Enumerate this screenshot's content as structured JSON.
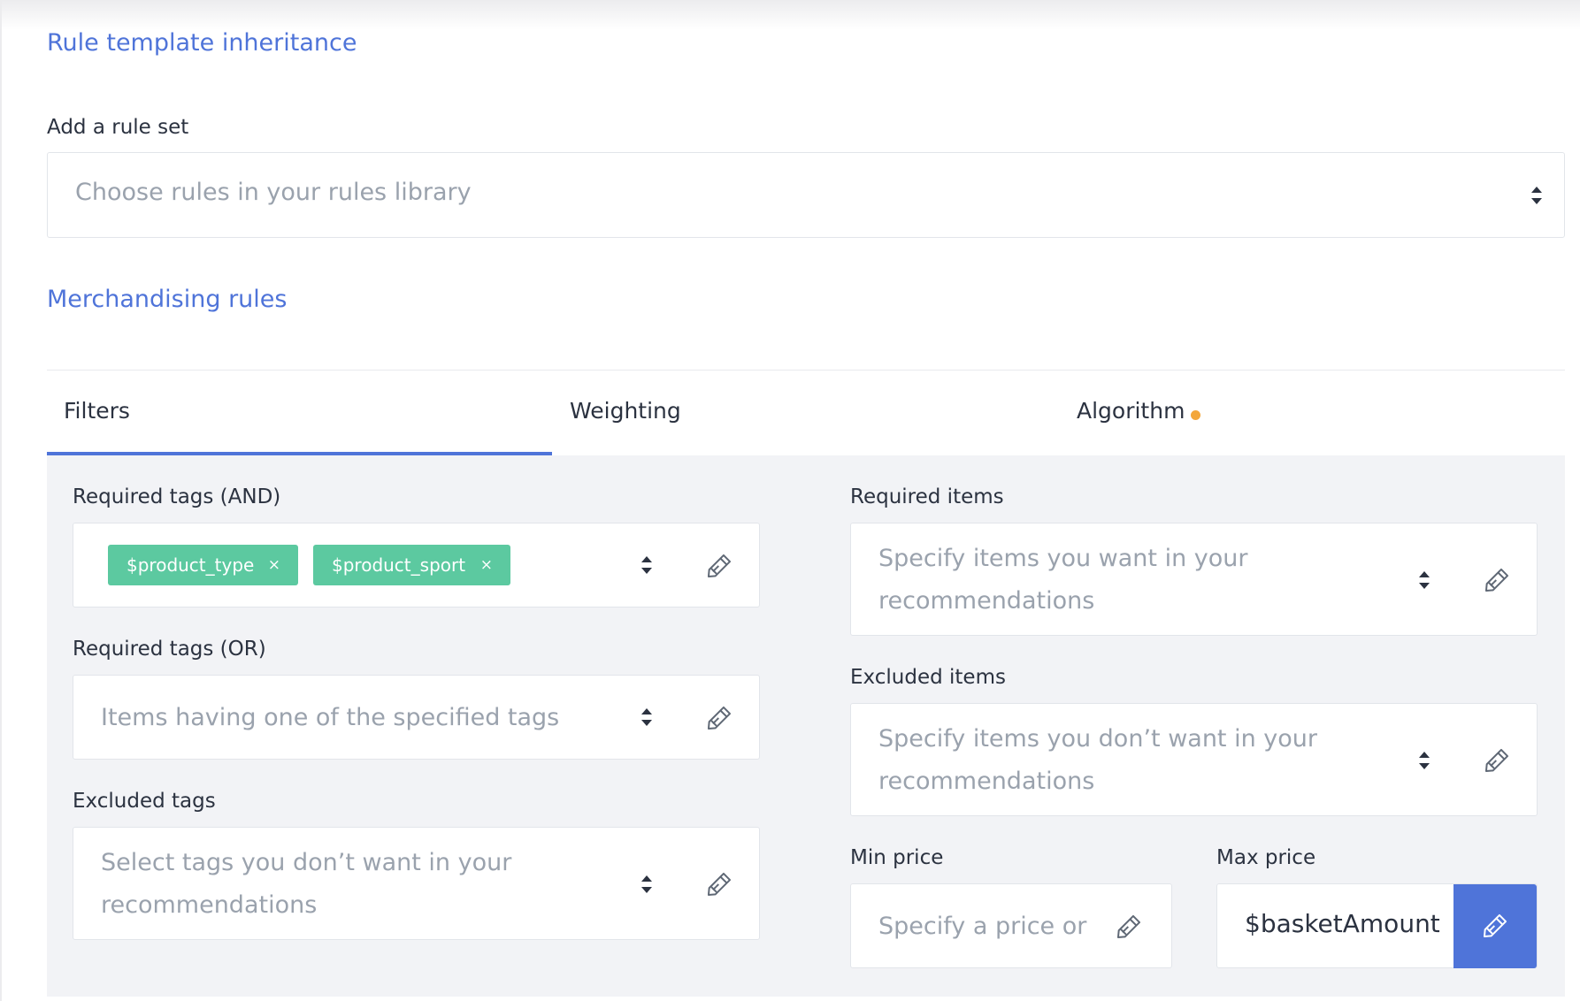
{
  "inheritance": {
    "title": "Rule template inheritance",
    "add_label": "Add a rule set",
    "placeholder": "Choose rules in your rules library"
  },
  "merch": {
    "title": "Merchandising rules",
    "tabs": [
      {
        "label": "Filters",
        "active": true
      },
      {
        "label": "Weighting",
        "active": false
      },
      {
        "label": "Algorithm",
        "active": false,
        "indicator": "orange-dot"
      }
    ]
  },
  "filters": {
    "required_and": {
      "label": "Required tags (AND)",
      "tags": [
        {
          "text": "$product_type",
          "remove": "×"
        },
        {
          "text": "$product_sport",
          "remove": "×"
        }
      ]
    },
    "required_or": {
      "label": "Required tags (OR)",
      "placeholder": "Items having one of the specified tags"
    },
    "excluded_tags": {
      "label": "Excluded tags",
      "placeholder": "Select tags you don’t want in your recommendations"
    },
    "required_items": {
      "label": "Required items",
      "placeholder": "Specify items you want in your recommendations"
    },
    "excluded_items": {
      "label": "Excluded items",
      "placeholder": "Specify items you don’t want in your recommendations"
    },
    "min_price": {
      "label": "Min price",
      "placeholder": "Specify a price or"
    },
    "max_price": {
      "label": "Max price",
      "value": "$basketAmount"
    }
  },
  "colors": {
    "accent": "#4f74d9",
    "tag": "#5cc9a0",
    "indicator": "#f3a73b",
    "panel": "#f2f3f6"
  },
  "icons": [
    "updown-arrows-icon",
    "pencil-icon"
  ]
}
